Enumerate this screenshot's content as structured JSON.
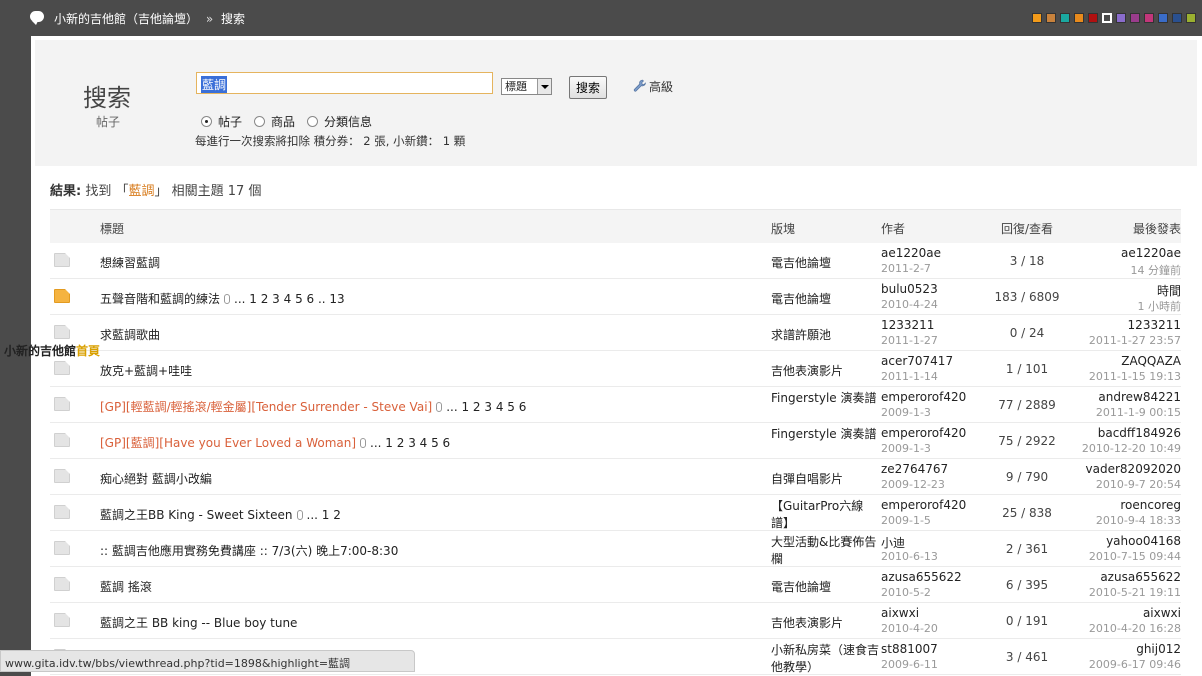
{
  "topbar": {
    "site": "小新的吉他館（吉他論壇）",
    "sep": "»",
    "page": "搜索"
  },
  "theme_colors": [
    "#f39b1a",
    "#c8823c",
    "#1aa8a0",
    "#e88a1c",
    "#b01010",
    "#ffffff",
    "#8a6ccc",
    "#9a3c8c",
    "#c2367a",
    "#3a6cc8",
    "#2a5090",
    "#9ab030"
  ],
  "search": {
    "title": "搜索",
    "subtitle": "帖子",
    "query": "藍調",
    "scope_selected": "標題",
    "button": "搜索",
    "advanced": "高級",
    "types": [
      {
        "label": "帖子",
        "checked": true
      },
      {
        "label": "商品",
        "checked": false
      },
      {
        "label": "分類信息",
        "checked": false
      }
    ],
    "cost_note": "每進行一次搜索將扣除 積分券： 2 張, 小新鑽： 1 顆"
  },
  "result": {
    "label": "結果:",
    "prefix": "找到 「",
    "keyword": "藍調",
    "suffix": "」 相關主題 17 個"
  },
  "table": {
    "headers": {
      "title": "標題",
      "board": "版塊",
      "author": "作者",
      "replies": "回復/查看",
      "last": "最後發表"
    },
    "rows": [
      {
        "title": "想練習藍調",
        "pages": "",
        "orange": false,
        "hot": false,
        "board": "電吉他論壇",
        "author": "ae1220ae",
        "date": "2011-2-7",
        "replies": "3  /  18",
        "last_user": "ae1220ae",
        "last_time": "14 分鐘前"
      },
      {
        "title": "五聲音階和藍調的練法",
        "pages": "... 1 2 3 4 5 6 .. 13",
        "orange": false,
        "hot": true,
        "board": "電吉他論壇",
        "author": "bulu0523",
        "date": "2010-4-24",
        "replies": "183  /  6809",
        "last_user": "時間",
        "last_time": "1 小時前"
      },
      {
        "title": "求藍調歌曲",
        "pages": "",
        "orange": false,
        "hot": false,
        "board": "求譜許願池",
        "author": "1233211",
        "date": "2011-1-27",
        "replies": "0  /  24",
        "last_user": "1233211",
        "last_time": "2011-1-27 23:57"
      },
      {
        "title": "放克+藍調+哇哇",
        "pages": "",
        "orange": false,
        "hot": false,
        "board": "吉他表演影片",
        "author": "acer707417",
        "date": "2011-1-14",
        "replies": "1  /  101",
        "last_user": "ZAQQAZA",
        "last_time": "2011-1-15 19:13"
      },
      {
        "title": "[GP][輕藍調/輕搖滾/輕金屬][Tender Surrender - Steve Vai]",
        "pages": "... 1 2 3 4 5 6",
        "orange": true,
        "hot": false,
        "board": "Fingerstyle 演奏譜",
        "author": "emperorof420",
        "date": "2009-1-3",
        "replies": "77  /  2889",
        "last_user": "andrew84221",
        "last_time": "2011-1-9 00:15"
      },
      {
        "title": "[GP][藍調][Have you Ever Loved a Woman]",
        "pages": "... 1 2 3 4 5 6",
        "orange": true,
        "hot": false,
        "board": "Fingerstyle 演奏譜",
        "author": "emperorof420",
        "date": "2009-1-3",
        "replies": "75  /  2922",
        "last_user": "bacdff184926",
        "last_time": "2010-12-20 10:49"
      },
      {
        "title": "痴心絕對 藍調小改編",
        "pages": "",
        "orange": false,
        "hot": false,
        "board": "自彈自唱影片",
        "author": "ze2764767",
        "date": "2009-12-23",
        "replies": "9  /  790",
        "last_user": "vader82092020",
        "last_time": "2010-9-7 20:54"
      },
      {
        "title": "藍調之王BB King - Sweet Sixteen",
        "pages": "... 1 2",
        "orange": false,
        "hot": false,
        "board": "【GuitarPro六線譜】",
        "author": "emperorof420",
        "date": "2009-1-5",
        "replies": "25  /  838",
        "last_user": "roencoreg",
        "last_time": "2010-9-4 18:33"
      },
      {
        "title": ":: 藍調吉他應用實務免費講座 :: 7/3(六) 晚上7:00-8:30",
        "pages": "",
        "orange": false,
        "hot": false,
        "board": "大型活動&比賽佈告欄",
        "author": "小迪",
        "date": "2010-6-13",
        "replies": "2  /  361",
        "last_user": "yahoo04168",
        "last_time": "2010-7-15 09:44"
      },
      {
        "title": "藍調 搖滾",
        "pages": "",
        "orange": false,
        "hot": false,
        "board": "電吉他論壇",
        "author": "azusa655622",
        "date": "2010-5-2",
        "replies": "6  /  395",
        "last_user": "azusa655622",
        "last_time": "2010-5-21 19:11"
      },
      {
        "title": "藍調之王 BB king -- Blue boy tune",
        "pages": "",
        "orange": false,
        "hot": false,
        "board": "吉他表演影片",
        "author": "aixwxi",
        "date": "2010-4-20",
        "replies": "0  /  191",
        "last_user": "aixwxi",
        "last_time": "2010-4-20 16:28"
      },
      {
        "title": "",
        "pages": "",
        "orange": false,
        "hot": false,
        "board": "小新私房菜（速食吉他教學）",
        "author": "st881007",
        "date": "2009-6-11",
        "replies": "3  /  461",
        "last_user": "ghij012",
        "last_time": "2009-6-17 09:46"
      }
    ]
  },
  "home_link": {
    "site": "小新的吉他館",
    "home": "首頁"
  },
  "statusbar": "www.gita.idv.tw/bbs/viewthread.php?tid=1898&highlight=藍調"
}
